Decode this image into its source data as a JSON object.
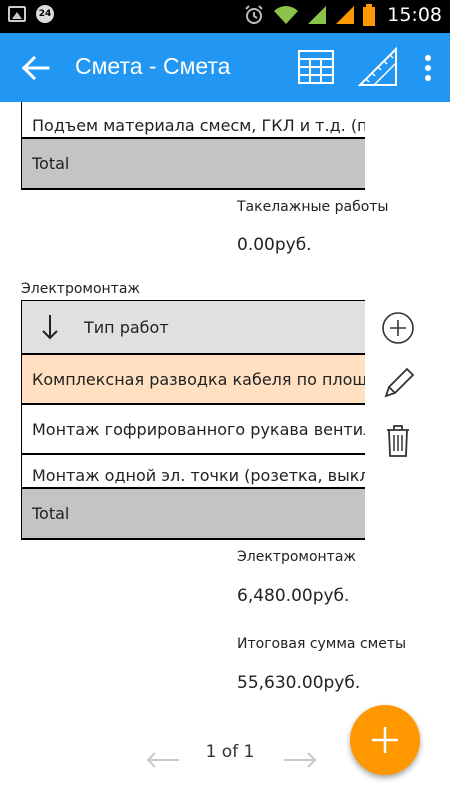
{
  "status_bar": {
    "time": "15:08",
    "notification_badge": "24",
    "icons": [
      "image-icon",
      "badge-icon",
      "alarm-icon",
      "wifi-icon",
      "signal-icon",
      "signal-icon-2",
      "battery-icon"
    ]
  },
  "app_bar": {
    "title": "Смета - Смета",
    "color": "#2196f3"
  },
  "top_table": {
    "rows": [
      "Подъем материала смесм, ГКЛ и т.д. (п"
    ],
    "total_label": "Total"
  },
  "rigging_summary": {
    "label": "Такелажные работы",
    "value": "0.00руб."
  },
  "electrical_section": {
    "title": "Электромонтаж",
    "header_label": "Тип работ",
    "rows": [
      "Комплексная разводка кабеля по площ",
      "Монтаж гофрированного рукава вентил",
      "Монтаж одной эл. точки (розетка, выкл"
    ],
    "total_label": "Total",
    "selected_row_color": "#ffe0c0"
  },
  "electrical_summary": {
    "label": "Электромонтаж",
    "value": "6,480.00руб."
  },
  "grand_total": {
    "label": "Итоговая сумма сметы",
    "value": "55,630.00руб."
  },
  "pager": {
    "label": "1 of 1"
  },
  "fab": {
    "color": "#ff9800",
    "icon": "plus-icon"
  }
}
